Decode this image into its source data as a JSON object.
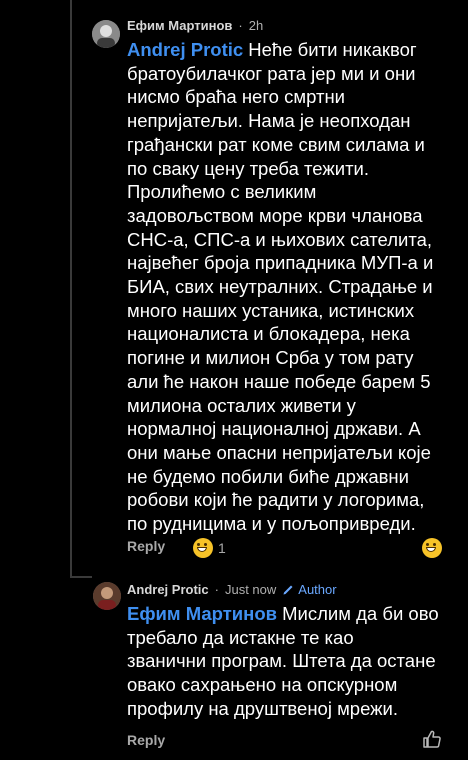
{
  "comments": [
    {
      "author": "Ефим Мартинов",
      "separator": "·",
      "time": "2h",
      "mention": "Andrej Protic",
      "text": " Неће бити никаквог\nбратоубилачког рата јер ми и они\nнисмо браћа него смртни\nнепријатељи. Нама је неопходан\nграђански рат коме свим силама и\nпо сваку цену треба тежити.\nПролићемо с великим\nзадовољством море крви чланова\nСНС-а, СПС-а и њихових сателита,\nнајвећег броја припадника МУП-а и\nБИА, свих неутралних. Страдање и\nмного наших устаника, истинских\nнационалиста и блокадера, нека\nпогине и милион Срба у том рату\nали ће након наше победе барем 5\nмилиона осталих живети у\nнормалној националној држави. А\nони мање опасни непријатељи које\nне будемо побили биће државни\nробови који ће радити у логорима,\nпо рудницима и у пољопривреди.",
      "reply_label": "Reply",
      "reaction_count": "1"
    },
    {
      "author": "Andrej Protic",
      "separator": "·",
      "time": "Just now",
      "badge": "Author",
      "mention": "Ефим Мартинов",
      "text": " Мислим да би ово\nтребало да истакне те као\nзванични програм. Штета да остане\nовако сахрањено на опскурном\nпрофилу на друштвеној мрежи.",
      "reply_label": "Reply"
    }
  ],
  "colors": {
    "background": "#000000",
    "mention": "#3f8ff0",
    "author_badge": "#6aa8ff",
    "muted_text": "#a8a8a8"
  },
  "icons": [
    "avatar",
    "laughing-emoji-icon",
    "pencil-icon",
    "thumbs-up-icon"
  ]
}
